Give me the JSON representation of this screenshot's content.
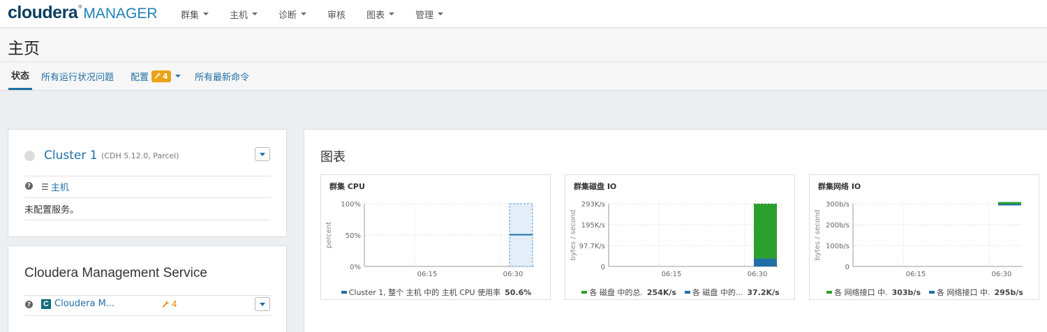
{
  "nav": {
    "logo_word": "cloudera",
    "logo_reg": "®",
    "logo_manager": "MANAGER",
    "menu": [
      {
        "label": "群集",
        "has_caret": true
      },
      {
        "label": "主机",
        "has_caret": true
      },
      {
        "label": "诊断",
        "has_caret": true
      },
      {
        "label": "审核",
        "has_caret": false
      },
      {
        "label": "图表",
        "has_caret": true
      },
      {
        "label": "管理",
        "has_caret": true
      }
    ]
  },
  "page": {
    "title": "主页"
  },
  "tabs": {
    "status": "状态",
    "health_issues": "所有运行状况问题",
    "config": "配置",
    "config_badge": "4",
    "recent_commands": "所有最新命令"
  },
  "cluster": {
    "name": "Cluster 1",
    "version": "(CDH 5.12.0, Parcel)",
    "hosts_link": "主机",
    "no_services": "未配置服务。"
  },
  "mgmt": {
    "title": "Cloudera Management Service",
    "link": "Cloudera M...",
    "config_issues": "4"
  },
  "charts_section": {
    "title": "图表"
  },
  "charts": [
    {
      "title": "群集 CPU",
      "ylabel": "percent",
      "yticks": [
        "100%",
        "50%",
        "0%"
      ],
      "xticks": [
        "06:15",
        "06:30"
      ],
      "legend": [
        {
          "label": "Cluster 1, 整个 主机 中的 主机 CPU 使用率",
          "value": "50.6%",
          "color": "#1f6fa5"
        }
      ]
    },
    {
      "title": "群集磁盘 IO",
      "ylabel": "bytes / second",
      "yticks": [
        "293K/s",
        "195K/s",
        "97.7K/s",
        "0"
      ],
      "xticks": [
        "06:15",
        "06:30"
      ],
      "legend": [
        {
          "label": "各 磁盘 中的总.",
          "value": "254K/s",
          "color": "#2ca02c"
        },
        {
          "label": "各 磁盘 中的...",
          "value": "37.2K/s",
          "color": "#1f6fa5"
        }
      ]
    },
    {
      "title": "群集网络 IO",
      "ylabel": "bytes / second",
      "yticks": [
        "300b/s",
        "200b/s",
        "100b/s",
        "0"
      ],
      "xticks": [
        "06:15",
        "06:30"
      ],
      "legend": [
        {
          "label": "各 网络接口 中.",
          "value": "303b/s",
          "color": "#2ca02c"
        },
        {
          "label": "各 网络接口 中.",
          "value": "295b/s",
          "color": "#1f6fa5"
        }
      ]
    }
  ],
  "chart_data": [
    {
      "type": "line",
      "title": "群集 CPU",
      "ylabel": "percent",
      "ylim": [
        0,
        100
      ],
      "x": [
        "06:30"
      ],
      "series": [
        {
          "name": "Cluster 1, 整个 主机 中的 主机 CPU 使用率",
          "values": [
            50.6
          ]
        }
      ]
    },
    {
      "type": "area",
      "title": "群集磁盘 IO",
      "ylabel": "bytes / second",
      "ylim": [
        0,
        293
      ],
      "x": [
        "06:30"
      ],
      "series": [
        {
          "name": "各 磁盘 中的总.",
          "values": [
            254
          ]
        },
        {
          "name": "各 磁盘 中的...",
          "values": [
            37.2
          ]
        }
      ]
    },
    {
      "type": "line",
      "title": "群集网络 IO",
      "ylabel": "bytes / second",
      "ylim": [
        0,
        300
      ],
      "x": [
        "06:30"
      ],
      "series": [
        {
          "name": "各 网络接口 中.",
          "values": [
            303
          ]
        },
        {
          "name": "各 网络接口 中.",
          "values": [
            295
          ]
        }
      ]
    }
  ]
}
